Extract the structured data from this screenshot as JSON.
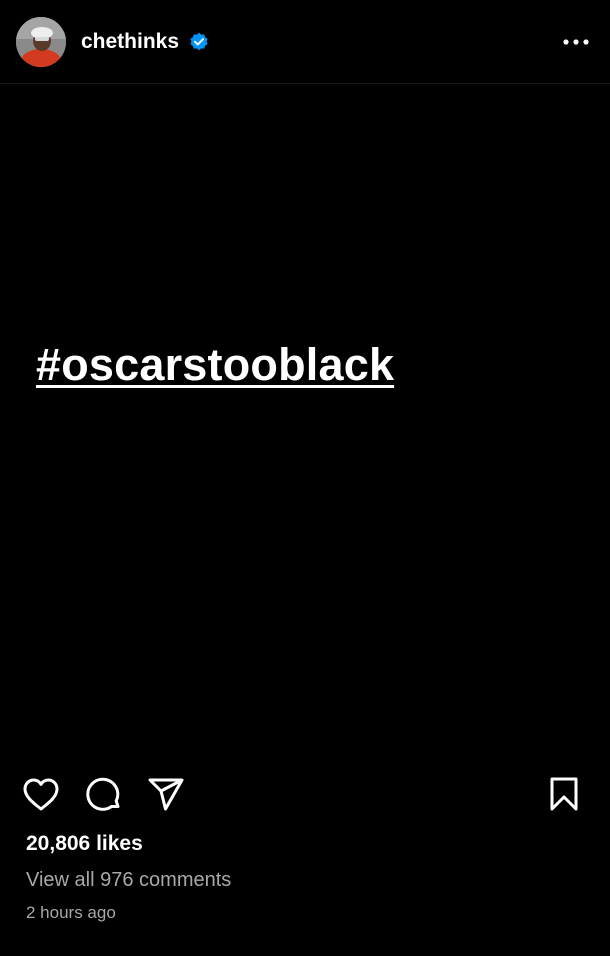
{
  "post": {
    "username": "chethinks",
    "verified": true,
    "hashtag_text": "#oscarstooblack",
    "likes_text": "20,806 likes",
    "comments_text": "View all 976 comments",
    "time_text": "2 hours ago"
  },
  "icons": {
    "avatar": "profile-avatar",
    "verified": "verified-badge-icon",
    "more": "more-options-icon",
    "like": "heart-icon",
    "comment": "comment-bubble-icon",
    "share": "paper-plane-icon",
    "save": "bookmark-icon"
  },
  "colors": {
    "background": "#000000",
    "text": "#ffffff",
    "secondary_text": "#a8a8a8",
    "verified_blue": "#0095f6"
  }
}
